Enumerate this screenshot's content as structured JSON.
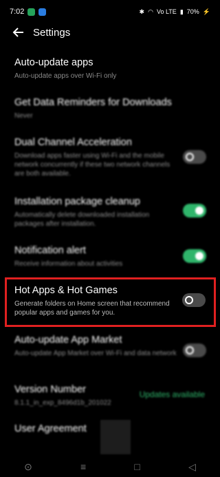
{
  "status": {
    "time": "7:02",
    "battery": "70%",
    "signal": "Vo LTE"
  },
  "header": {
    "title": "Settings"
  },
  "items": [
    {
      "title": "Auto-update apps",
      "desc": "Auto-update apps over Wi-Fi only"
    },
    {
      "title": "Get Data Reminders for Downloads",
      "desc": "Never"
    },
    {
      "title": "Dual Channel Acceleration",
      "desc": "Download apps faster using Wi-Fi and the mobile network concurrently if these two network channels are both available."
    },
    {
      "title": "Installation package cleanup",
      "desc": "Automatically delete downloaded installation packages after installation."
    },
    {
      "title": "Notification alert",
      "desc": "Receive information about activities"
    },
    {
      "title": "Hot Apps & Hot Games",
      "desc": "Generate folders on Home screen that recommend popular apps and games for you."
    },
    {
      "title": "Auto-update App Market",
      "desc": "Auto-update App Market over Wi-Fi and data network"
    },
    {
      "title": "Version Number",
      "desc": "8.1.1_in_exp_8496d1b_201022"
    },
    {
      "title": "User Agreement",
      "desc": ""
    }
  ],
  "updates_label": "Updates available",
  "toggles": {
    "dual": false,
    "cleanup": true,
    "notification": true,
    "hot": false,
    "market": false
  },
  "colors": {
    "accent": "#2fb56b",
    "highlight": "#e02020"
  }
}
